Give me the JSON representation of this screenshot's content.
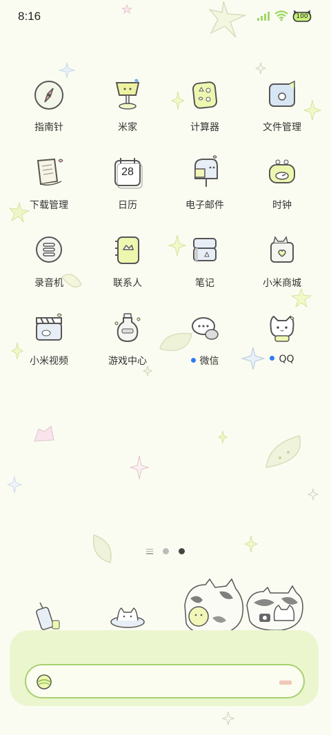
{
  "status_bar": {
    "time": "8:16",
    "battery_level": "100",
    "icons": [
      "signal-icon",
      "wifi-icon",
      "battery-icon"
    ]
  },
  "apps": [
    {
      "label": "指南针",
      "icon": "compass-icon",
      "badge": false
    },
    {
      "label": "米家",
      "icon": "mijia-lamp-icon",
      "badge": false
    },
    {
      "label": "计算器",
      "icon": "calculator-icon",
      "badge": false
    },
    {
      "label": "文件管理",
      "icon": "folder-icon",
      "badge": false
    },
    {
      "label": "下载管理",
      "icon": "download-scroll-icon",
      "badge": false
    },
    {
      "label": "日历",
      "icon": "calendar-icon",
      "badge": false
    },
    {
      "label": "电子邮件",
      "icon": "mailbox-icon",
      "badge": false
    },
    {
      "label": "时钟",
      "icon": "clock-icon",
      "badge": false
    },
    {
      "label": "录音机",
      "icon": "recorder-icon",
      "badge": false
    },
    {
      "label": "联系人",
      "icon": "contacts-book-icon",
      "badge": false
    },
    {
      "label": "笔记",
      "icon": "notebook-icon",
      "badge": false
    },
    {
      "label": "小米商城",
      "icon": "shop-bag-icon",
      "badge": false
    },
    {
      "label": "小米视频",
      "icon": "video-clapper-icon",
      "badge": false
    },
    {
      "label": "游戏中心",
      "icon": "potion-bottle-icon",
      "badge": false
    },
    {
      "label": "微信",
      "icon": "wechat-bubbles-icon",
      "badge": true
    },
    {
      "label": "QQ",
      "icon": "qq-cat-icon",
      "badge": true
    }
  ],
  "calendar_day": "28",
  "page_indicator": {
    "pages": 2,
    "active": 2
  },
  "search_bar": {
    "icon": "search-ball-icon"
  },
  "colors": {
    "background": "#fbfcf1",
    "dock": "#ebf6cf",
    "search_border": "#a8d070",
    "badge": "#2f7bf5"
  }
}
